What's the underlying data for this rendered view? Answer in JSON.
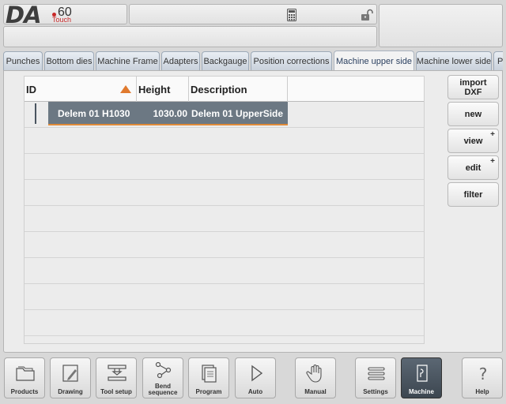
{
  "logo": {
    "brand": "DA",
    "model": "60",
    "variant": "Touch"
  },
  "tabs": [
    {
      "label": "Punches"
    },
    {
      "label": "Bottom dies"
    },
    {
      "label": "Machine Frame"
    },
    {
      "label": "Adapters"
    },
    {
      "label": "Backgauge"
    },
    {
      "label": "Position corrections"
    },
    {
      "label": "Machine upper side",
      "active": true
    },
    {
      "label": "Machine lower side"
    },
    {
      "label": "P"
    }
  ],
  "table": {
    "columns": [
      "ID",
      "Height",
      "Description"
    ],
    "sort": {
      "column": "ID",
      "direction": "ascending"
    },
    "rows": [
      {
        "id": "Delem 01 H1030",
        "height": "1030.00",
        "description": "Delem 01 UpperSide",
        "selected": true
      }
    ]
  },
  "side_buttons": {
    "import_line1": "import",
    "import_line2": "DXF",
    "new": "new",
    "view": "view",
    "edit": "edit",
    "filter": "filter",
    "expand_mark": "+"
  },
  "bottom_nav": [
    {
      "label": "Products",
      "icon": "folder-icon"
    },
    {
      "label": "Drawing",
      "icon": "drawing-icon"
    },
    {
      "label": "Tool setup",
      "icon": "tool-setup-icon"
    },
    {
      "label": "Bend sequence",
      "icon": "bend-sequence-icon"
    },
    {
      "label": "Program",
      "icon": "program-icon"
    },
    {
      "label": "Auto",
      "icon": "play-icon"
    },
    {
      "label": "Manual",
      "icon": "hand-icon"
    },
    {
      "label": "Settings",
      "icon": "settings-list-icon"
    },
    {
      "label": "Machine",
      "icon": "machine-icon",
      "active": true
    },
    {
      "label": "Help",
      "icon": "help-icon"
    }
  ],
  "colors": {
    "accent": "#e07a2e",
    "selection": "#6c7883",
    "brand_red": "#c82828",
    "active_nav": "#4a5560"
  }
}
